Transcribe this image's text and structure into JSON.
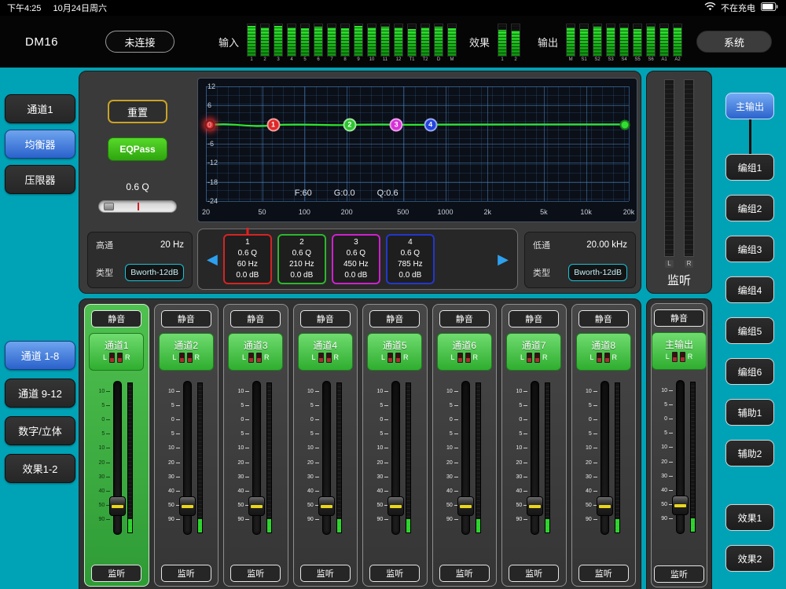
{
  "status_bar": {
    "time": "下午4:25",
    "date": "10月24日周六",
    "battery_text": "不在充电"
  },
  "header": {
    "app_title": "DM16",
    "connect_button": "未连接",
    "input_label": "输入",
    "fx_label": "效果",
    "output_label": "输出",
    "system_button": "系统",
    "input_meters": {
      "labels": [
        "1",
        "2",
        "3",
        "4",
        "5",
        "6",
        "7",
        "8",
        "9",
        "10",
        "11",
        "12",
        "T1",
        "T2",
        "D",
        "M"
      ],
      "levels": [
        0.93,
        0.88,
        0.95,
        0.9,
        0.86,
        0.92,
        0.9,
        0.87,
        0.94,
        0.89,
        0.91,
        0.88,
        0.85,
        0.9,
        0.92,
        0.87
      ]
    },
    "fx_meters": {
      "labels": [
        "1",
        "2"
      ],
      "levels": [
        0.82,
        0.78
      ]
    },
    "output_meters": {
      "labels": [
        "M",
        "S1",
        "S2",
        "S3",
        "S4",
        "S5",
        "S6",
        "A1",
        "A2"
      ],
      "levels": [
        0.9,
        0.85,
        0.92,
        0.88,
        0.9,
        0.84,
        0.91,
        0.86,
        0.89
      ]
    }
  },
  "left_nav_top": [
    {
      "label": "通道1",
      "active": false
    },
    {
      "label": "均衡器",
      "active": true
    },
    {
      "label": "压限器",
      "active": false
    }
  ],
  "left_nav_bottom": [
    {
      "label": "通道 1-8",
      "active": true
    },
    {
      "label": "通道 9-12",
      "active": false
    },
    {
      "label": "数字/立体",
      "active": false
    },
    {
      "label": "效果1-2",
      "active": false
    }
  ],
  "icons": {
    "prev_band": "◀",
    "next_band": "▶"
  },
  "eq": {
    "reset_button": "重置",
    "eqpass_button": "EQPass",
    "q_readout": "0.6 Q",
    "graph": {
      "y_ticks": [
        "12",
        "6",
        "0",
        "-6",
        "-12",
        "-18",
        "-24"
      ],
      "x_ticks": [
        {
          "label": "20",
          "pos": 0
        },
        {
          "label": "50",
          "pos": 13.3
        },
        {
          "label": "100",
          "pos": 23.3
        },
        {
          "label": "200",
          "pos": 33.3
        },
        {
          "label": "500",
          "pos": 46.6
        },
        {
          "label": "1000",
          "pos": 56.6
        },
        {
          "label": "2k",
          "pos": 66.6
        },
        {
          "label": "5k",
          "pos": 79.9
        },
        {
          "label": "10k",
          "pos": 89.9
        },
        {
          "label": "20k",
          "pos": 100
        }
      ],
      "overlay": {
        "f": "F:60",
        "g": "G:0.0",
        "q": "Q:0.6"
      },
      "hpf_dot": {
        "color": "#e83030",
        "pos": 1
      },
      "lpf_dot": {
        "color": "#30dd30",
        "pos": 99
      },
      "points": [
        {
          "num": "1",
          "color": "#e02828",
          "pos": 15.9
        },
        {
          "num": "2",
          "color": "#2fc42f",
          "pos": 34.0
        },
        {
          "num": "3",
          "color": "#d830d8",
          "pos": 45.0
        },
        {
          "num": "4",
          "color": "#2244dd",
          "pos": 53.1
        }
      ]
    },
    "hpf": {
      "name": "高通",
      "freq": "20 Hz",
      "type_label": "类型",
      "type": "Bworth-12dB"
    },
    "lpf": {
      "name": "低通",
      "freq": "20.00 kHz",
      "type_label": "类型",
      "type": "Bworth-12dB"
    },
    "bands": [
      {
        "num": "1",
        "q": "0.6 Q",
        "freq": "60 Hz",
        "gain": "0.0 dB",
        "color": "#d42424",
        "selected": true
      },
      {
        "num": "2",
        "q": "0.6 Q",
        "freq": "210 Hz",
        "gain": "0.0 dB",
        "color": "#2fb52f",
        "selected": false
      },
      {
        "num": "3",
        "q": "0.6 Q",
        "freq": "450 Hz",
        "gain": "0.0 dB",
        "color": "#cc22cc",
        "selected": false
      },
      {
        "num": "4",
        "q": "0.6 Q",
        "freq": "785 Hz",
        "gain": "0.0 dB",
        "color": "#2238cc",
        "selected": false
      }
    ]
  },
  "monitor": {
    "label": "监听",
    "channel_labels": [
      "L",
      "R"
    ]
  },
  "output_nav": [
    {
      "label": "主输出",
      "active": true
    },
    {
      "label": "编组1",
      "active": false
    },
    {
      "label": "编组2",
      "active": false
    },
    {
      "label": "编组3",
      "active": false
    },
    {
      "label": "编组4",
      "active": false
    },
    {
      "label": "编组5",
      "active": false
    },
    {
      "label": "编组6",
      "active": false
    },
    {
      "label": "辅助1",
      "active": false
    },
    {
      "label": "辅助2",
      "active": false
    },
    {
      "label": "效果1",
      "active": false
    },
    {
      "label": "效果2",
      "active": false
    }
  ],
  "fader_scale": [
    "10",
    "5",
    "0",
    "5",
    "10",
    "20",
    "30",
    "40",
    "50",
    "90"
  ],
  "strip_labels": {
    "mute": "静音",
    "listen": "监听",
    "lr": [
      "L",
      "R"
    ]
  },
  "channels": [
    {
      "name": "通道1",
      "active": true
    },
    {
      "name": "通道2",
      "active": false
    },
    {
      "name": "通道3",
      "active": false
    },
    {
      "name": "通道4",
      "active": false
    },
    {
      "name": "通道5",
      "active": false
    },
    {
      "name": "通道6",
      "active": false
    },
    {
      "name": "通道7",
      "active": false
    },
    {
      "name": "通道8",
      "active": false
    }
  ],
  "master": {
    "name": "主输出",
    "active": false
  },
  "colors": {
    "background_teal": "#00a2b6",
    "active_blue": "#3f78d8",
    "channel_green": "#3cbf3c",
    "eq_curve": "#2ee62e"
  }
}
